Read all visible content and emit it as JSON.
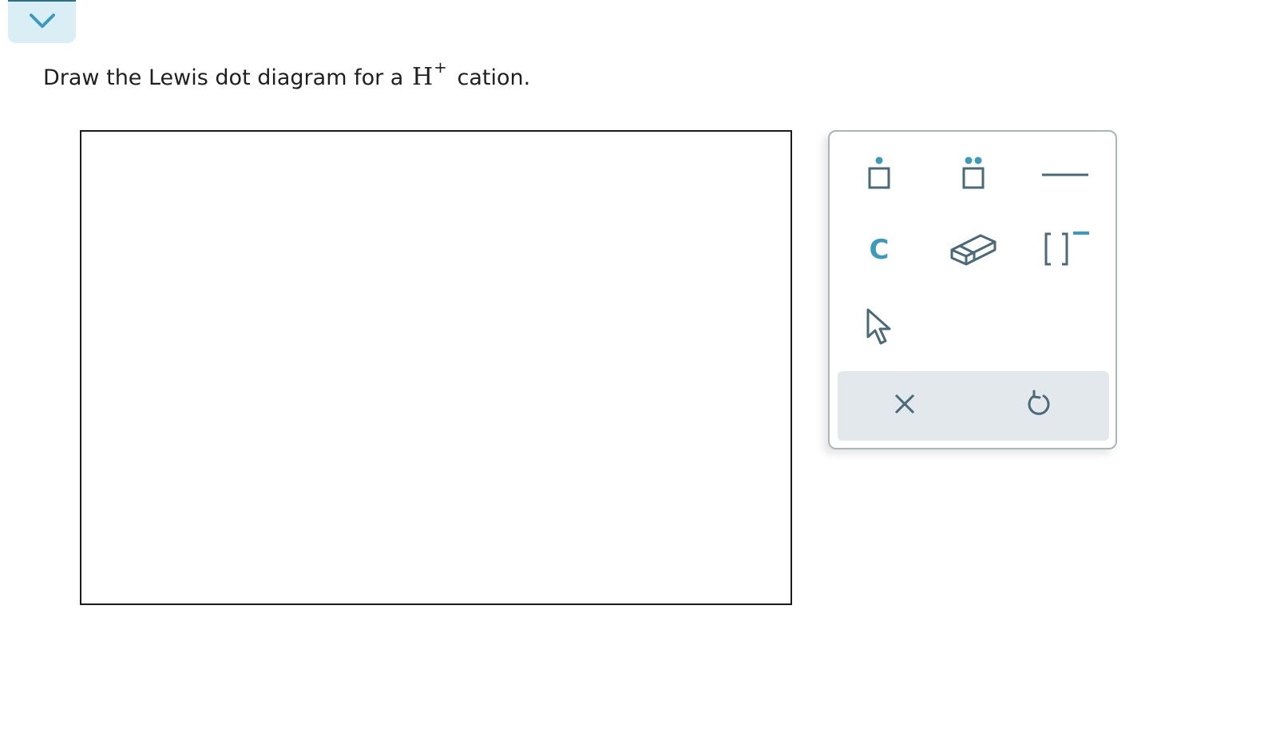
{
  "question": {
    "prefix": "Draw the Lewis dot diagram for a",
    "species_symbol": "H",
    "species_charge": "+",
    "suffix": "cation."
  },
  "palette": {
    "tools": [
      {
        "name": "single-electron",
        "icon": "single-dot-box-icon"
      },
      {
        "name": "electron-pair",
        "icon": "double-dot-box-icon"
      },
      {
        "name": "bond",
        "icon": "bond-line-icon"
      },
      {
        "name": "atom",
        "icon": "element-c-icon",
        "label": "C"
      },
      {
        "name": "eraser",
        "icon": "eraser-icon"
      },
      {
        "name": "bracket-charge",
        "icon": "bracket-charge-icon",
        "label": "[]"
      },
      {
        "name": "select",
        "icon": "pointer-icon"
      }
    ],
    "actions": [
      {
        "name": "clear",
        "icon": "close-icon"
      },
      {
        "name": "undo",
        "icon": "undo-icon"
      }
    ]
  },
  "colors": {
    "accent": "#3a9bba",
    "icon_dark": "#4a6a78",
    "action_bar_bg": "#e2e8eb",
    "collapse_bg": "#d9eef5"
  }
}
